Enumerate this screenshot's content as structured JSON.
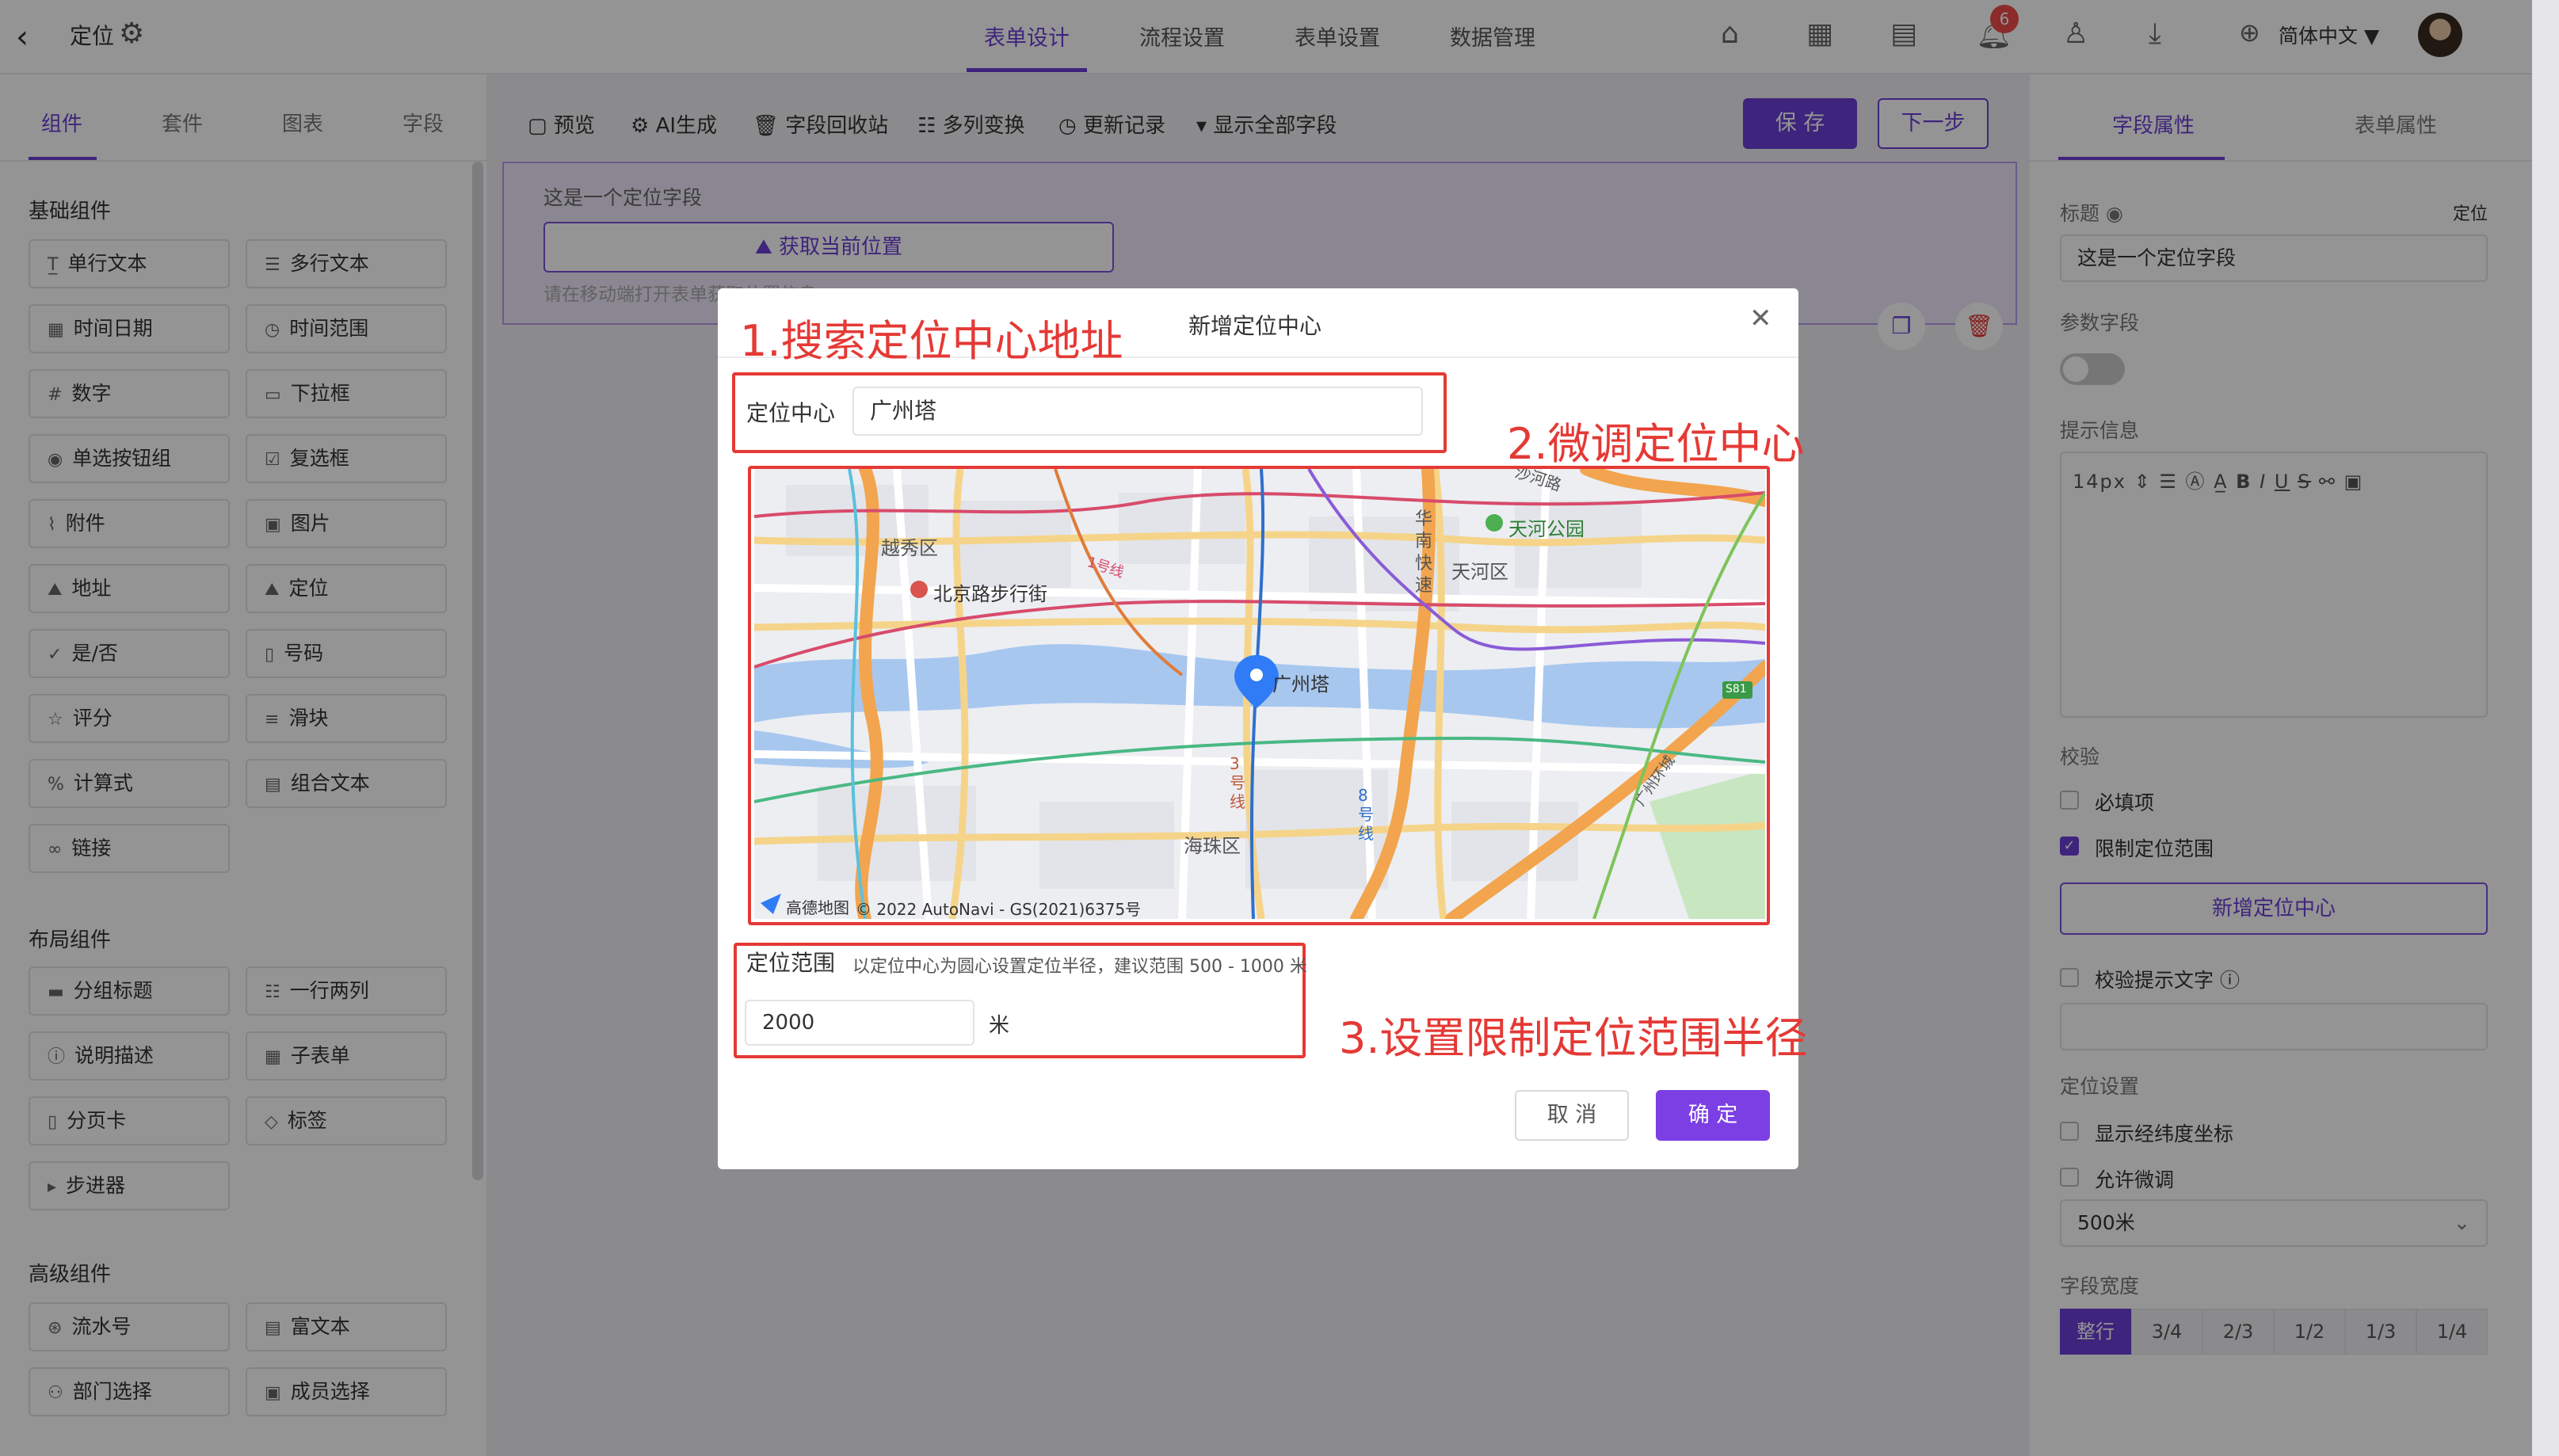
{
  "header": {
    "back_icon": "‹",
    "title": "定位",
    "nav_tabs": [
      "表单设计",
      "流程设置",
      "表单设置",
      "数据管理"
    ],
    "active_tab": "表单设计",
    "notification_count": "6",
    "language": "简体中文"
  },
  "left_panel": {
    "tabs": [
      "组件",
      "套件",
      "图表",
      "字段"
    ],
    "sections": [
      {
        "title": "基础组件",
        "items": [
          "单行文本",
          "多行文本",
          "时间日期",
          "时间范围",
          "数字",
          "下拉框",
          "单选按钮组",
          "复选框",
          "附件",
          "图片",
          "地址",
          "定位",
          "是/否",
          "号码",
          "评分",
          "滑块",
          "计算式",
          "组合文本",
          "链接"
        ]
      },
      {
        "title": "布局组件",
        "items": [
          "分组标题",
          "一行两列",
          "说明描述",
          "子表单",
          "分页卡",
          "标签",
          "步进器"
        ]
      },
      {
        "title": "高级组件",
        "items": [
          "流水号",
          "富文本",
          "部门选择",
          "成员选择"
        ]
      }
    ]
  },
  "toolbar": {
    "items": [
      "预览",
      "AI生成",
      "字段回收站",
      "多列变换",
      "更新记录",
      "显示全部字段"
    ],
    "save": "保 存",
    "next": "下一步"
  },
  "canvas": {
    "field_label": "这是一个定位字段",
    "get_location_button": "获取当前位置",
    "hint": "请在移动端打开表单获取位置信息"
  },
  "right_panel": {
    "tabs": [
      "字段属性",
      "表单属性"
    ],
    "title_label": "标题",
    "title_type": "定位",
    "title_value": "这是一个定位字段",
    "param_label": "参数字段",
    "tip_label": "提示信息",
    "font_size": "14px",
    "validate_label": "校验",
    "required": "必填项",
    "limit_range": "限制定位范围",
    "add_center": "新增定位中心",
    "validate_tip": "校验提示文字",
    "loc_settings_label": "定位设置",
    "show_coords": "显示经纬度坐标",
    "allow_adjust": "允许微调",
    "distance": "500米",
    "width_label": "字段宽度",
    "width_options": [
      "整行",
      "3/4",
      "2/3",
      "1/2",
      "1/3",
      "1/4"
    ]
  },
  "modal": {
    "title": "新增定位中心",
    "center_label": "定位中心",
    "center_value": "广州塔",
    "range_label": "定位范围",
    "range_hint": "以定位中心为圆心设置定位半径，建议范围 500 - 1000 米",
    "range_value": "2000",
    "unit": "米",
    "cancel": "取 消",
    "ok": "确 定"
  },
  "annotations": {
    "step1": "1.搜索定位中心地址",
    "step2": "2.微调定位中心",
    "step3": "3.设置限制定位范围半径"
  },
  "map": {
    "labels": {
      "yuexiu": "越秀区",
      "beijinglu": "北京路步行街",
      "tianhe_park": "天河公园",
      "tianhe": "天河区",
      "huanan": "华南快速",
      "canton_tower": "广州塔",
      "haizhu": "海珠区",
      "line3": "3号线",
      "line8": "8号线",
      "line1": "1号线",
      "s81": "S81",
      "road_top": "沙河路",
      "road_right": "广州环城"
    },
    "brand": "高德地图",
    "copyright": "© 2022 AutoNavi - GS(2021)6375号"
  }
}
